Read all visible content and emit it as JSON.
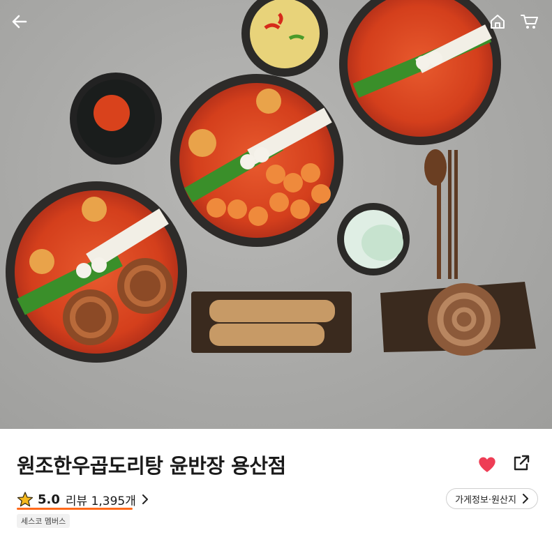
{
  "store": {
    "name": "원조한우곱도리탕 윤반장 용산점",
    "rating": "5.0",
    "review_label": "리뷰 1,395개",
    "info_button": "가게정보·원산지",
    "member_badge": "세스코 멤버스"
  },
  "icons": {
    "back": "arrow-left-icon",
    "home": "home-icon",
    "cart": "cart-icon",
    "star": "star-icon",
    "heart": "heart-icon",
    "share": "share-icon",
    "chevron": "chevron-right-icon"
  },
  "colors": {
    "accent": "#ff6a1a",
    "heart": "#ee3d55",
    "star": "#f6b91d"
  }
}
